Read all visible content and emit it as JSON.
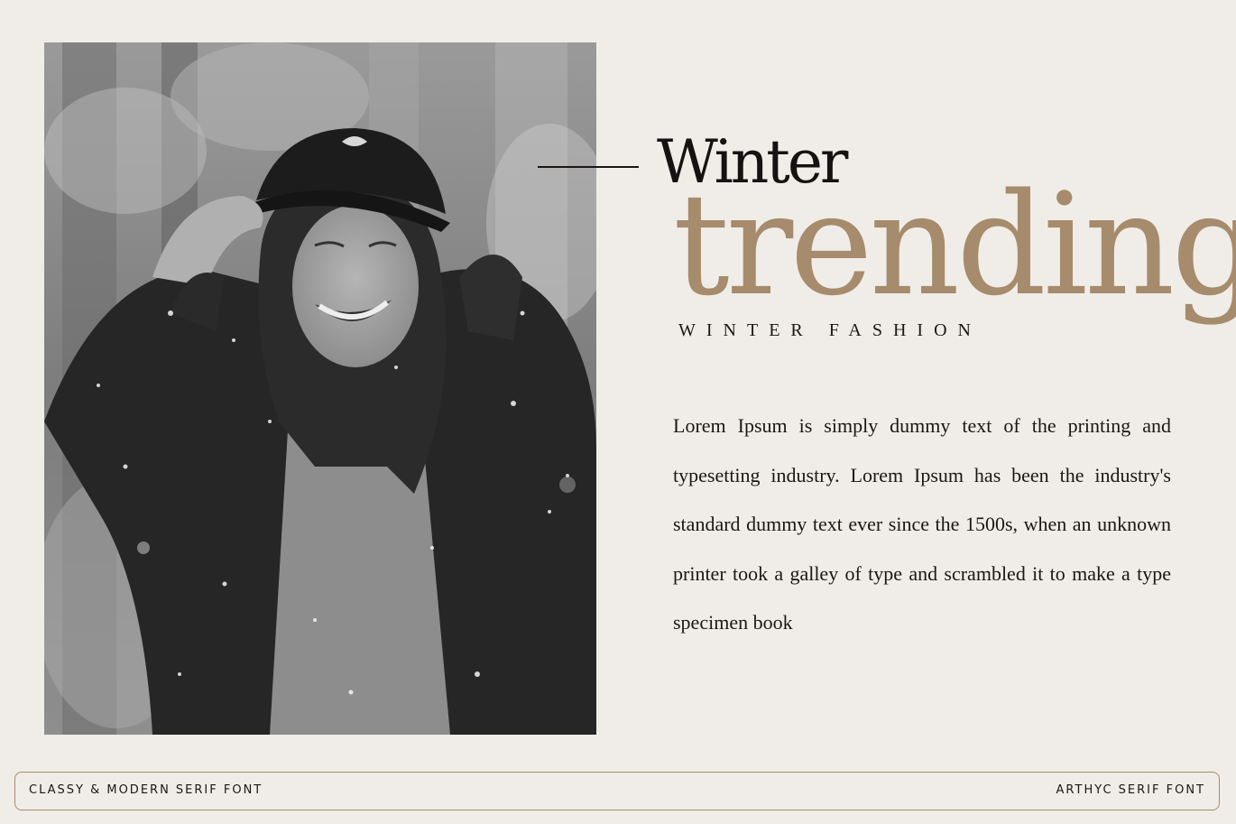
{
  "headline": {
    "winter": "Winter",
    "trending": "trending",
    "subtitle": "WINTER FASHION"
  },
  "body": {
    "paragraph": "Lorem Ipsum is simply dummy text of the printing and typesetting industry. Lorem Ipsum has been the industry's standard dummy text ever since the 1500s, when an unknown printer took a galley of type and scrambled it to make a type specimen book"
  },
  "footer": {
    "left_label": "CLASSY & MODERN SERIF FONT",
    "right_label": "ARTHYC SERIF FONT"
  },
  "colors": {
    "background": "#f0ede8",
    "accent": "#a68b6c",
    "text": "#1a1715"
  }
}
